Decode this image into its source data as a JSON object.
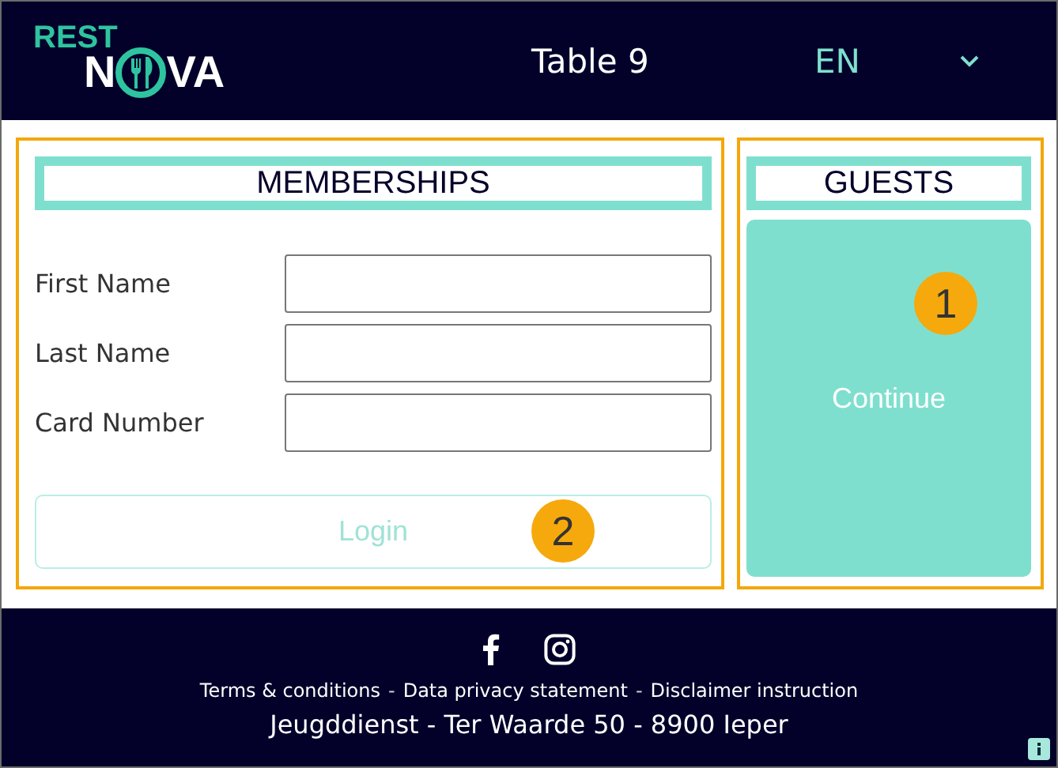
{
  "header": {
    "logo": {
      "top": "REST",
      "bottom_left": "N",
      "bottom_right": "VA"
    },
    "title": "Table 9",
    "language": "EN"
  },
  "memberships": {
    "title": "MEMBERSHIPS",
    "fields": [
      {
        "label": "First Name"
      },
      {
        "label": "Last Name"
      },
      {
        "label": "Card Number"
      }
    ],
    "login": {
      "label": "Login",
      "disabled": true,
      "badge": "2"
    }
  },
  "guests": {
    "title": "GUESTS",
    "continue": {
      "label": "Continue",
      "badge": "1"
    }
  },
  "footer": {
    "links": [
      {
        "kind": "link",
        "text": "Terms & conditions"
      },
      {
        "kind": "separator",
        "text": "-"
      },
      {
        "kind": "link",
        "text": "Data privacy statement"
      },
      {
        "kind": "separator",
        "text": "-"
      },
      {
        "kind": "link",
        "text": "Disclaimer instruction"
      }
    ],
    "address": "Jeugddienst - Ter Waarde 50 - 8900 Ieper"
  }
}
